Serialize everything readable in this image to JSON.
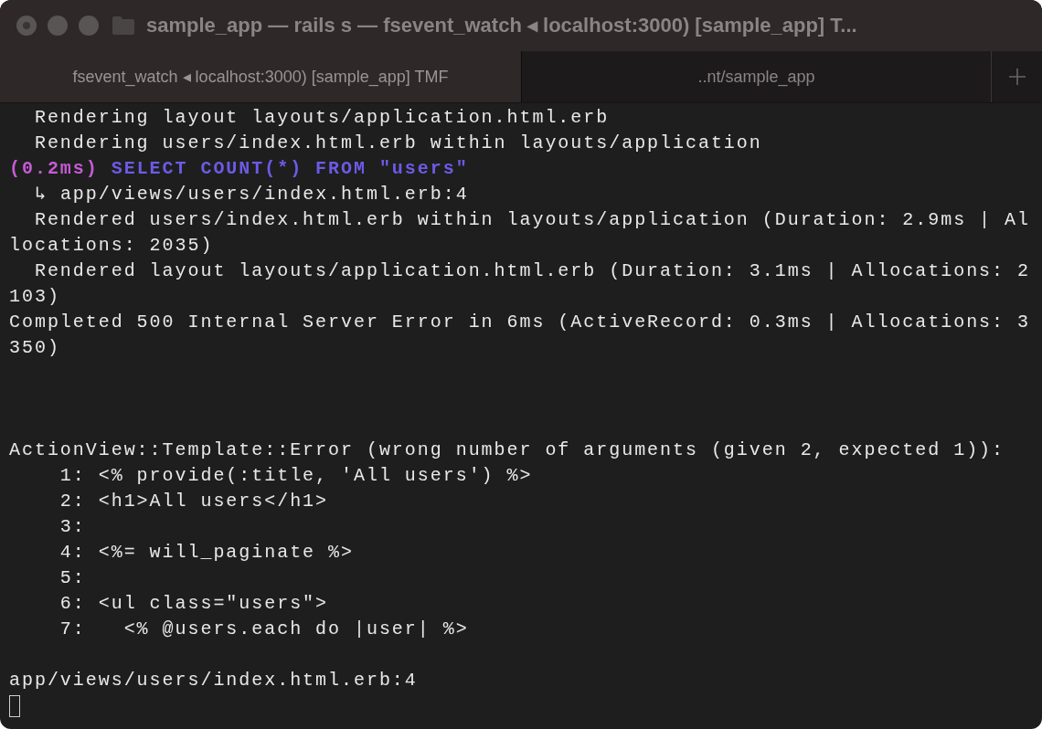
{
  "window": {
    "title": "sample_app — rails s — fsevent_watch ◂ localhost:3000) [sample_app] T..."
  },
  "tabs": [
    {
      "label": "fsevent_watch ◂ localhost:3000) [sample_app] TMF",
      "selected": true
    },
    {
      "label": "..nt/sample_app",
      "selected": false
    }
  ],
  "terminal": {
    "lines": [
      {
        "kind": "text",
        "text": "  Rendering layout layouts/application.html.erb"
      },
      {
        "kind": "text",
        "text": "  Rendering users/index.html.erb within layouts/application"
      },
      {
        "kind": "sql",
        "duration": "(0.2ms)",
        "query": "SELECT COUNT(*) FROM \"users\""
      },
      {
        "kind": "text",
        "text": "  ↳ app/views/users/index.html.erb:4"
      },
      {
        "kind": "text",
        "text": "  Rendered users/index.html.erb within layouts/application (Duration: 2.9ms | Al"
      },
      {
        "kind": "text",
        "text": "locations: 2035)"
      },
      {
        "kind": "text",
        "text": "  Rendered layout layouts/application.html.erb (Duration: 3.1ms | Allocations: 2"
      },
      {
        "kind": "text",
        "text": "103)"
      },
      {
        "kind": "text",
        "text": "Completed 500 Internal Server Error in 6ms (ActiveRecord: 0.3ms | Allocations: 3"
      },
      {
        "kind": "text",
        "text": "350)"
      },
      {
        "kind": "blank"
      },
      {
        "kind": "blank"
      },
      {
        "kind": "blank"
      },
      {
        "kind": "text",
        "text": "ActionView::Template::Error (wrong number of arguments (given 2, expected 1)):"
      },
      {
        "kind": "text",
        "text": "    1: <% provide(:title, 'All users') %>"
      },
      {
        "kind": "text",
        "text": "    2: <h1>All users</h1>"
      },
      {
        "kind": "text",
        "text": "    3:"
      },
      {
        "kind": "text",
        "text": "    4: <%= will_paginate %>"
      },
      {
        "kind": "text",
        "text": "    5:"
      },
      {
        "kind": "text",
        "text": "    6: <ul class=\"users\">"
      },
      {
        "kind": "text",
        "text": "    7:   <% @users.each do |user| %>"
      },
      {
        "kind": "blank"
      },
      {
        "kind": "text",
        "text": "app/views/users/index.html.erb:4"
      },
      {
        "kind": "cursor"
      }
    ]
  }
}
